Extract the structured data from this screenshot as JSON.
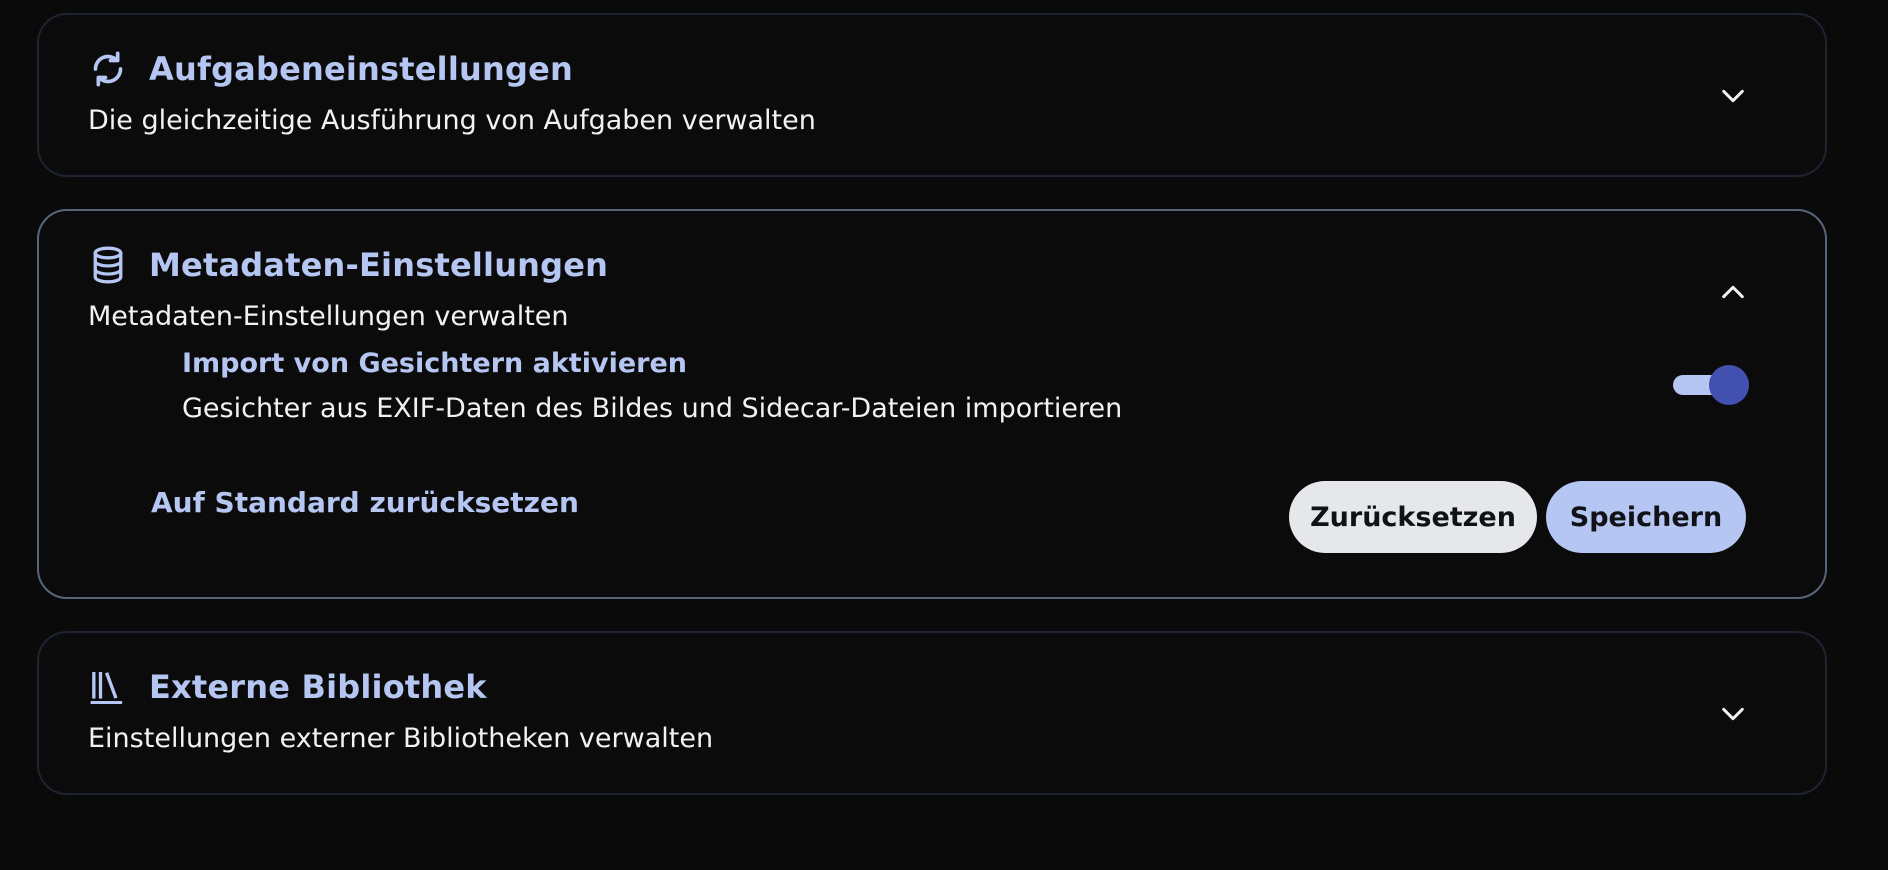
{
  "sections": [
    {
      "icon": "sync-icon",
      "title": "Aufgabeneinstellungen",
      "subtitle": "Die gleichzeitige Ausführung von Aufgaben verwalten",
      "expanded": false
    },
    {
      "icon": "database-icon",
      "title": "Metadaten-Einstellungen",
      "subtitle": "Metadaten-Einstellungen verwalten",
      "expanded": true,
      "settings": [
        {
          "title": "Import von Gesichtern aktivieren",
          "description": "Gesichter aus EXIF-Daten des Bildes und Sidecar-Dateien importieren",
          "enabled": true
        }
      ],
      "reset_default_label": "Auf Standard zurücksetzen",
      "reset_label": "Zurücksetzen",
      "save_label": "Speichern"
    },
    {
      "icon": "library-icon",
      "title": "Externe Bibliothek",
      "subtitle": "Einstellungen externer Bibliotheken verwalten",
      "expanded": false
    }
  ],
  "colors": {
    "background": "#0a0a0b",
    "accent": "#b6c6f2",
    "toggle_knob": "#4250af",
    "border": "#1e2430",
    "border_open": "#596579"
  }
}
